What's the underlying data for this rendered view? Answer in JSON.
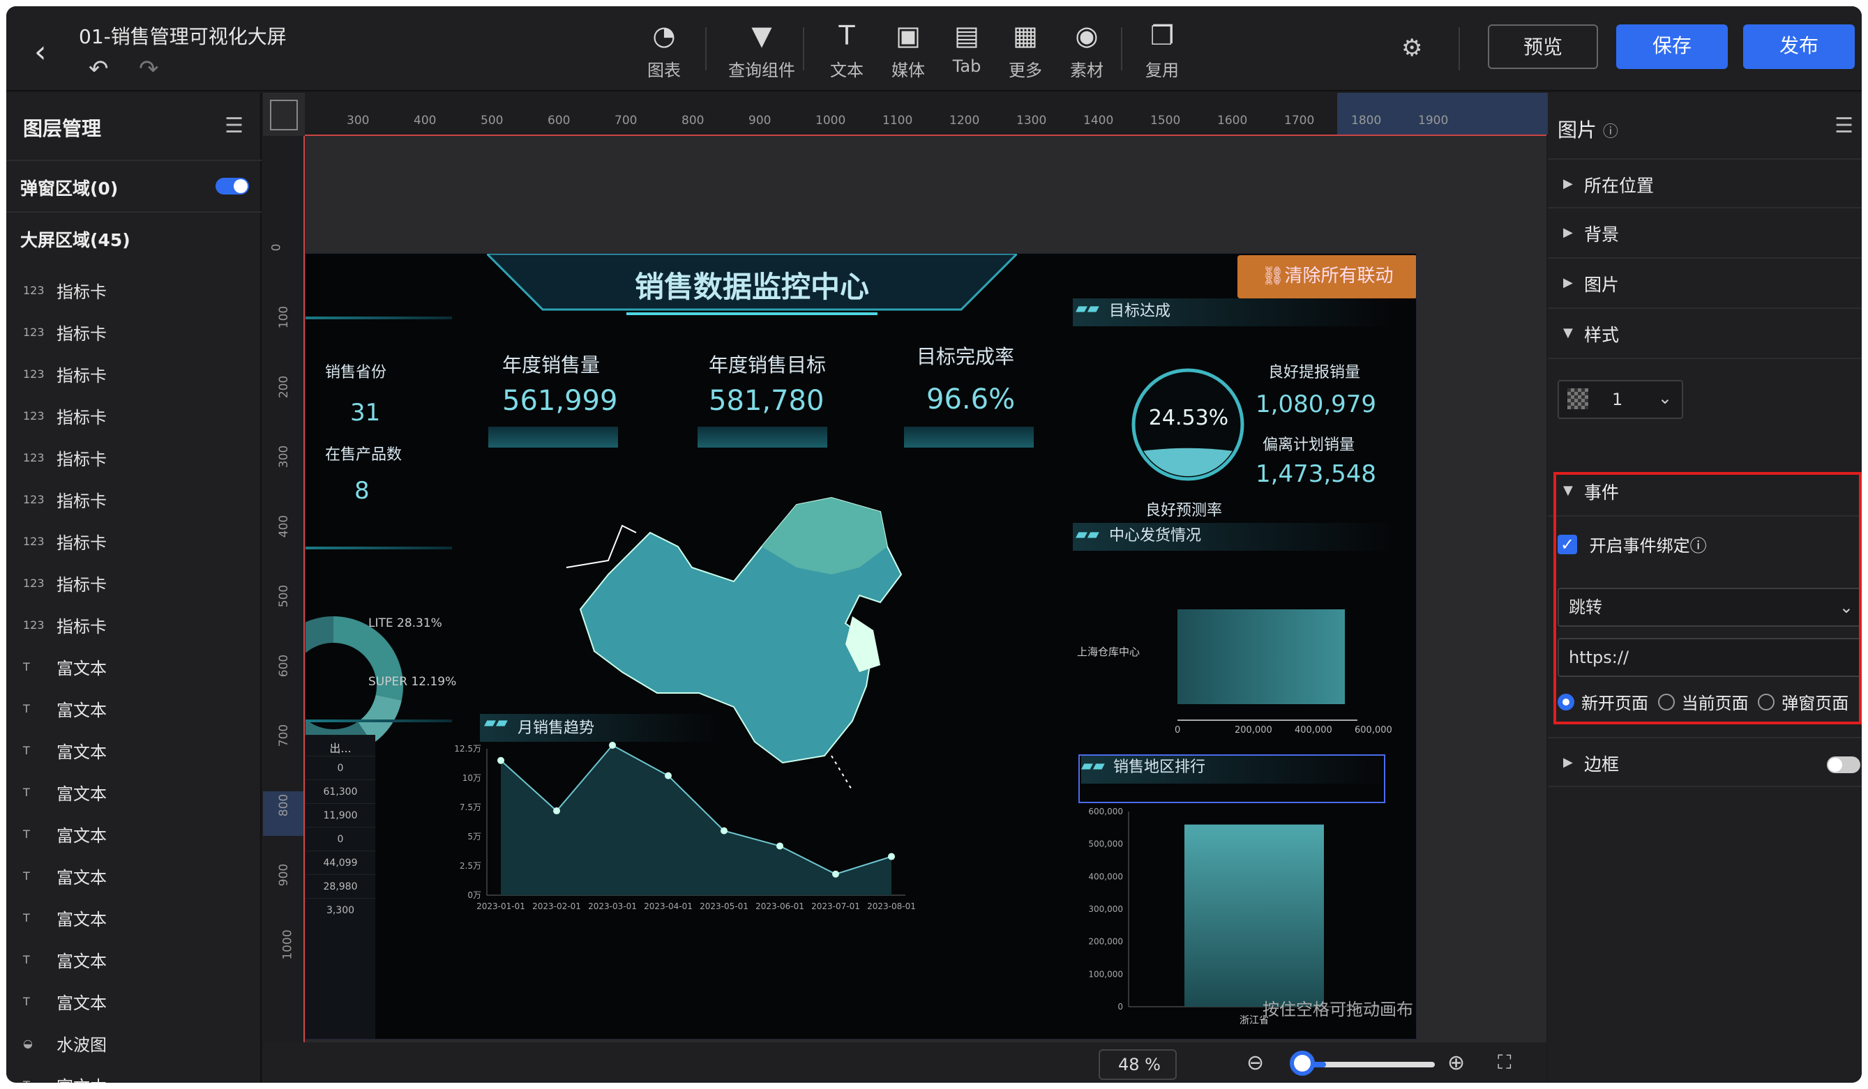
{
  "header": {
    "title": "01-销售管理可视化大屏",
    "back": "‹",
    "undo": "↶",
    "redo": "↷"
  },
  "toolbar": {
    "tools": [
      {
        "label": "图表",
        "icon": "pie-chart-icon",
        "glyph": "◔"
      },
      {
        "label": "查询组件",
        "icon": "filter-icon",
        "glyph": "▼"
      },
      {
        "label": "文本",
        "icon": "text-icon",
        "glyph": "T"
      },
      {
        "label": "媒体",
        "icon": "image-icon",
        "glyph": "▣"
      },
      {
        "label": "Tab",
        "icon": "tab-icon",
        "glyph": "▤"
      },
      {
        "label": "更多",
        "icon": "grid-icon",
        "glyph": "▦"
      },
      {
        "label": "素材",
        "icon": "palette-icon",
        "glyph": "◉"
      },
      {
        "label": "复用",
        "icon": "copy-icon",
        "glyph": "❐"
      }
    ],
    "preview": "预览",
    "save": "保存",
    "publish": "发布"
  },
  "left": {
    "title": "图层管理",
    "popup": "弹窗区域(0)",
    "bigscreen": "大屏区域(45)",
    "layers": [
      {
        "icon": "123",
        "label": "指标卡"
      },
      {
        "icon": "123",
        "label": "指标卡"
      },
      {
        "icon": "123",
        "label": "指标卡"
      },
      {
        "icon": "123",
        "label": "指标卡"
      },
      {
        "icon": "123",
        "label": "指标卡"
      },
      {
        "icon": "123",
        "label": "指标卡"
      },
      {
        "icon": "123",
        "label": "指标卡"
      },
      {
        "icon": "123",
        "label": "指标卡"
      },
      {
        "icon": "123",
        "label": "指标卡"
      },
      {
        "icon": "T",
        "label": "富文本"
      },
      {
        "icon": "T",
        "label": "富文本"
      },
      {
        "icon": "T",
        "label": "富文本"
      },
      {
        "icon": "T",
        "label": "富文本"
      },
      {
        "icon": "T",
        "label": "富文本"
      },
      {
        "icon": "T",
        "label": "富文本"
      },
      {
        "icon": "T",
        "label": "富文本"
      },
      {
        "icon": "T",
        "label": "富文本"
      },
      {
        "icon": "T",
        "label": "富文本"
      },
      {
        "icon": "◒",
        "label": "水波图"
      },
      {
        "icon": "T",
        "label": "富文本"
      }
    ]
  },
  "ruler": {
    "h": [
      "300",
      "400",
      "500",
      "600",
      "700",
      "800",
      "900",
      "1000",
      "1100",
      "1200",
      "1300",
      "1400",
      "1500",
      "1600",
      "1700",
      "1800",
      "1900"
    ],
    "v": [
      "0",
      "100",
      "200",
      "300",
      "400",
      "500",
      "600",
      "700",
      "800",
      "900",
      "1000"
    ]
  },
  "screen": {
    "title": "销售数据监控中心",
    "clear_link": "清除所有联动",
    "prov_label": "销售省份",
    "prov_val": "31",
    "prod_label": "在售产品数",
    "prod_val": "8",
    "kpi": [
      {
        "t": "年度销售量",
        "v": "561,999"
      },
      {
        "t": "年度销售目标",
        "v": "581,780"
      },
      {
        "t": "目标完成率",
        "v": "96.6%"
      }
    ],
    "target": {
      "title": "目标达成",
      "pct": "24.53%",
      "pct_label": "良好预测率",
      "good": "良好提报销量",
      "good_v": "1,080,979",
      "dev": "偏离计划销量",
      "dev_v": "1,473,548"
    },
    "ship": {
      "title": "中心发货情况",
      "cat": "上海仓库中心",
      "ticks": [
        "0",
        "200,000",
        "400,000",
        "600,000"
      ]
    },
    "donut": {
      "l1": "LITE 28.31%",
      "l2": "SUPER 12.19%"
    },
    "trend": {
      "title": "月销售趋势"
    },
    "rank": {
      "title": "销售地区排行",
      "cat": "浙江省"
    },
    "table": {
      "head": "出...",
      "rows": [
        "0",
        "61,300",
        "11,900",
        "0",
        "44,099",
        "28,980",
        "3,300"
      ]
    },
    "hint": "按住空格可拖动画布"
  },
  "zoom": {
    "value": "48 %"
  },
  "right": {
    "title": "图片",
    "sections": [
      "所在位置",
      "背景",
      "图片",
      "样式"
    ],
    "style_val": "1",
    "event": "事件",
    "bind": "开启事件绑定",
    "action": "跳转",
    "url": "https://",
    "r1": "新开页面",
    "r2": "当前页面",
    "r3": "弹窗页面",
    "border": "边框"
  },
  "chart_data": [
    {
      "type": "line",
      "title": "月销售趋势",
      "x": [
        "2023-01-01",
        "2023-02-01",
        "2023-03-01",
        "2023-04-01",
        "2023-05-01",
        "2023-06-01",
        "2023-07-01",
        "2023-08-01"
      ],
      "values": [
        115000,
        72000,
        128000,
        102000,
        55000,
        42000,
        18000,
        33000
      ],
      "ylim": [
        0,
        125000
      ],
      "yticks": [
        "0万",
        "2.5万",
        "5万",
        "7.5万",
        "10万",
        "12.5万"
      ]
    },
    {
      "type": "bar",
      "title": "销售地区排行",
      "categories": [
        "浙江省"
      ],
      "values": [
        560000
      ],
      "ylim": [
        0,
        600000
      ],
      "yticks": [
        "0",
        "100,000",
        "200,000",
        "300,000",
        "400,000",
        "500,000",
        "600,000"
      ]
    },
    {
      "type": "pie",
      "series": [
        {
          "name": "LITE",
          "value": 28.31
        },
        {
          "name": "SUPER",
          "value": 12.19
        }
      ]
    }
  ]
}
